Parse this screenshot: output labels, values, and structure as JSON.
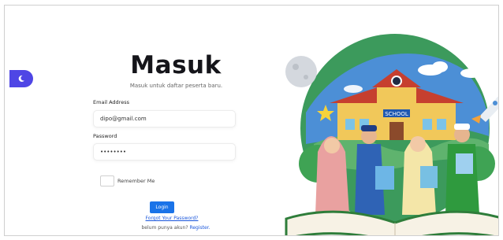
{
  "login": {
    "title": "Masuk",
    "subtitle": "Masuk untuk daftar peserta baru.",
    "email_label": "Email Address",
    "email_value": "dipo@gmail.com",
    "password_label": "Password",
    "password_value": "••••••••",
    "remember_label": "Remember Me",
    "login_label": "Login",
    "forgot_label": "Forgot Your Password?",
    "register_prompt": "belum punya akun?",
    "register_link": "Register."
  },
  "illustration": {
    "school_sign": "SCHOOL"
  },
  "icons": {
    "theme_toggle": "moon-icon"
  },
  "colors": {
    "accent": "#4f46e5",
    "button": "#1a73e8",
    "link": "#1a56db"
  }
}
